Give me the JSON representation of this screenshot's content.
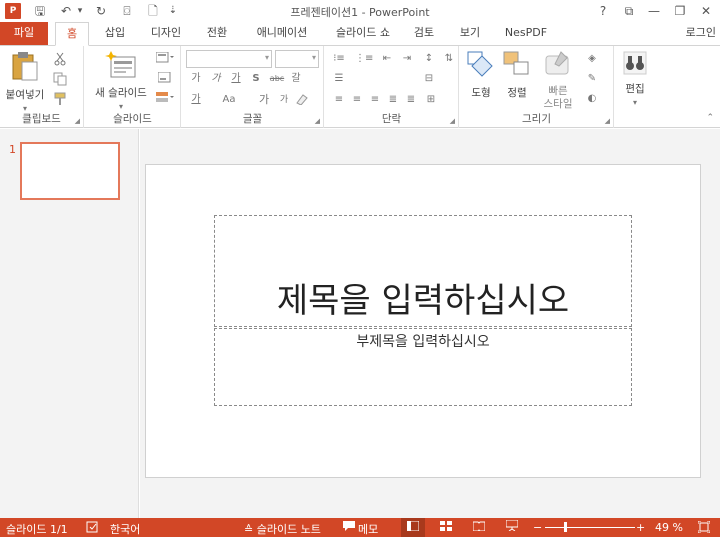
{
  "window": {
    "title": "프레젠테이션1 - PowerPoint",
    "app_badge": "P",
    "qat": {
      "save": "🖫",
      "undo": "↶",
      "undo_menu": "▾",
      "redo": "↻",
      "present": "⌼",
      "new": "🗋",
      "customize": "⇣"
    },
    "controls": {
      "help": "?",
      "ribbon_options": "⧉",
      "minimize": "—",
      "restore": "❐",
      "close": "✕"
    }
  },
  "tabs": [
    {
      "label": "파일"
    },
    {
      "label": "홈"
    },
    {
      "label": "삽입"
    },
    {
      "label": "디자인"
    },
    {
      "label": "전환"
    },
    {
      "label": "애니메이션"
    },
    {
      "label": "슬라이드 쇼"
    },
    {
      "label": "검토"
    },
    {
      "label": "보기"
    },
    {
      "label": "NesPDF"
    }
  ],
  "signin": "로그인",
  "ribbon": {
    "clipboard": {
      "label": "클립보드",
      "paste": "붙여넣기",
      "paste_arrow": "▾"
    },
    "slides": {
      "label": "슬라이드",
      "new_slide": "새 슬라이드",
      "new_slide_arrow": "▾"
    },
    "font": {
      "label": "글꼴",
      "row1": [
        "가",
        "가",
        "가",
        "S",
        "abc",
        "갈"
      ],
      "row2": [
        "가",
        "Aa"
      ],
      "grow": "가",
      "shrink": "가"
    },
    "paragraph": {
      "label": "단락"
    },
    "drawing": {
      "label": "그리기",
      "shapes": "도형",
      "arrange": "정렬",
      "quick_styles_1": "빠른",
      "quick_styles_2": "스타일"
    },
    "editing": {
      "label": "편집"
    }
  },
  "thumbnail": {
    "number": "1"
  },
  "slide": {
    "title_placeholder": "제목을 입력하십시오",
    "subtitle_placeholder": "부제목을 입력하십시오"
  },
  "status": {
    "slide_counter": "슬라이드 1/1",
    "language": "한국어",
    "notes": "≙ 슬라이드 노트",
    "comments": "메모",
    "zoom_minus": "−",
    "zoom_plus": "+",
    "zoom_level": "49 %",
    "zoom_fraction": 0.49
  },
  "colors": {
    "accent": "#d24726",
    "thumb_border": "#e4785a"
  }
}
